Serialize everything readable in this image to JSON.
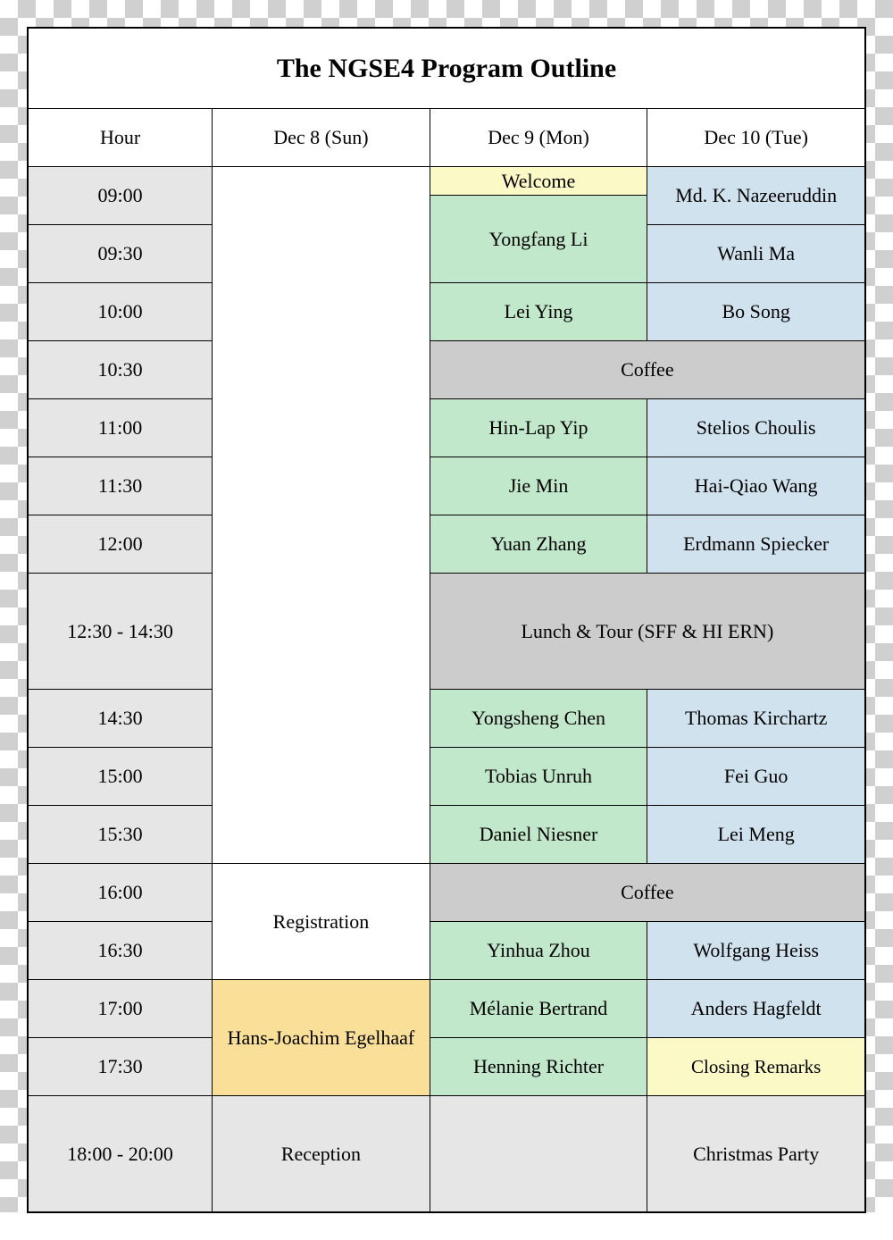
{
  "title": "The NGSE4 Program Outline",
  "headers": {
    "hour": "Hour",
    "day1": "Dec 8 (Sun)",
    "day2": "Dec 9 (Mon)",
    "day3": "Dec 10 (Tue)"
  },
  "hours": {
    "h0900": "09:00",
    "h0930": "09:30",
    "h1000": "10:00",
    "h1030": "10:30",
    "h1100": "11:00",
    "h1130": "11:30",
    "h1200": "12:00",
    "h1230_1430": "12:30 - 14:30",
    "h1430": "14:30",
    "h1500": "15:00",
    "h1530": "15:30",
    "h1600": "16:00",
    "h1630": "16:30",
    "h1700": "17:00",
    "h1730": "17:30",
    "h1800_2000": "18:00 - 20:00"
  },
  "day1": {
    "registration": "Registration",
    "talk": "Hans-Joachim Egelhaaf",
    "reception": "Reception"
  },
  "day2": {
    "welcome": "Welcome",
    "yongfang_li": "Yongfang Li",
    "lei_ying": "Lei Ying",
    "hin_lap_yip": "Hin-Lap Yip",
    "jie_min": "Jie Min",
    "yuan_zhang": "Yuan Zhang",
    "yongsheng_chen": "Yongsheng Chen",
    "tobias_unruh": "Tobias Unruh",
    "daniel_niesner": "Daniel Niesner",
    "yinhua_zhou": "Yinhua Zhou",
    "melanie_bertrand": "Mélanie Bertrand",
    "henning_richter": "Henning Richter"
  },
  "day3": {
    "nazeeruddin": "Md. K. Nazeeruddin",
    "wanli_ma": "Wanli Ma",
    "bo_song": "Bo Song",
    "stelios_choulis": "Stelios Choulis",
    "hai_qiao_wang": "Hai-Qiao Wang",
    "erdmann_spiecker": "Erdmann Spiecker",
    "thomas_kirchartz": "Thomas Kirchartz",
    "fei_guo": "Fei Guo",
    "lei_meng": "Lei Meng",
    "wolfgang_heiss": "Wolfgang Heiss",
    "anders_hagfeldt": "Anders Hagfeldt",
    "closing": "Closing Remarks",
    "christmas_party": "Christmas Party"
  },
  "shared": {
    "coffee": "Coffee",
    "lunch_tour": "Lunch & Tour (SFF & HI ERN)"
  }
}
